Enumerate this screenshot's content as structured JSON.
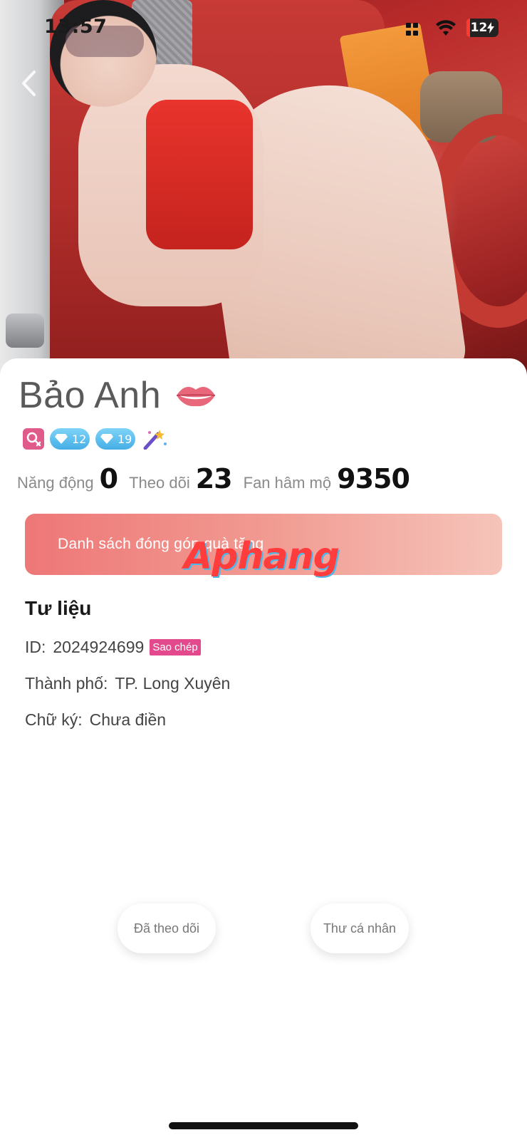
{
  "status_bar": {
    "time": "13:57",
    "battery": "12"
  },
  "profile": {
    "name": "Bảo Anh",
    "badges": {
      "diamond_1": "12",
      "diamond_2": "19"
    },
    "stats": [
      {
        "label": "Năng động",
        "value": "0"
      },
      {
        "label": "Theo dõi",
        "value": "23"
      },
      {
        "label": "Fan hâm mộ",
        "value": "9350"
      }
    ]
  },
  "gift_banner": {
    "label": "Danh sách đóng góp quà tặng"
  },
  "watermark": "Aphang",
  "info": {
    "title": "Tư liệu",
    "id_label": "ID:",
    "id_value": "2024924699",
    "copy_label": "Sao chép",
    "city_label": "Thành phố:",
    "city_value": "TP. Long Xuyên",
    "signature_label": "Chữ ký:",
    "signature_value": "Chưa điền"
  },
  "actions": {
    "follow_label": "Đã theo dõi",
    "message_label": "Thư cá nhân"
  },
  "colors": {
    "accent_pink": "#e24a8d",
    "banner_start": "#ee7777",
    "banner_end": "#f6c4ba",
    "diamond_badge": "#45aee5"
  },
  "icons": [
    "back-chevron-icon",
    "grid-signal-icon",
    "wifi-icon",
    "battery-icon",
    "lips-icon",
    "female-gender-icon",
    "diamond-icon",
    "magic-wand-icon"
  ]
}
